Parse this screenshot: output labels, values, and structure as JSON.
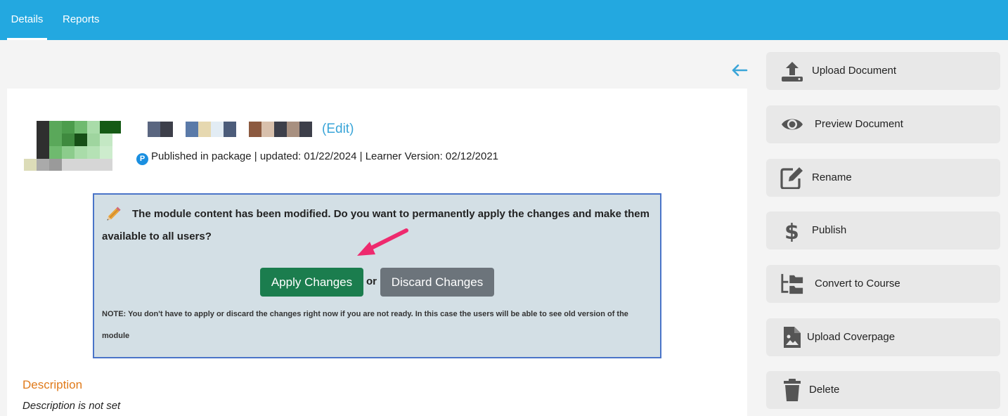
{
  "tabs": [
    {
      "label": "Details",
      "active": true
    },
    {
      "label": "Reports",
      "active": false
    }
  ],
  "module": {
    "edit_label": "(Edit)",
    "published_badge": "P",
    "meta_line": "Published in package | updated: 01/22/2024 | Learner Version: 02/12/2021"
  },
  "alert": {
    "message": "The module content has been modified. Do you want to permanently apply the changes and make them available to all users?",
    "apply_label": "Apply Changes",
    "or_label": "or",
    "discard_label": "Discard Changes",
    "note": "NOTE: You don't have to apply or discard the changes right now if you are not ready. In this case the users will be able to see old version of the module"
  },
  "description": {
    "heading": "Description",
    "text": "Description is not set"
  },
  "sidebar": {
    "items": [
      {
        "label": "Upload Document",
        "icon": "upload-icon"
      },
      {
        "label": "Preview Document",
        "icon": "eye-icon"
      },
      {
        "label": "Rename",
        "icon": "edit-icon"
      },
      {
        "label": "Publish",
        "icon": "dollar-icon"
      },
      {
        "label": "Convert to Course",
        "icon": "folder-tree-icon"
      },
      {
        "label": "Upload Coverpage",
        "icon": "file-image-icon"
      },
      {
        "label": "Delete",
        "icon": "trash-icon"
      }
    ]
  },
  "colors": {
    "topbar": "#23a8e0",
    "link": "#3aa5d8",
    "apply": "#1b7d4e",
    "discard": "#6c747b",
    "description_heading": "#e07a1a",
    "alert_border": "#4a74c8",
    "annotation_arrow": "#ee2a6e"
  }
}
